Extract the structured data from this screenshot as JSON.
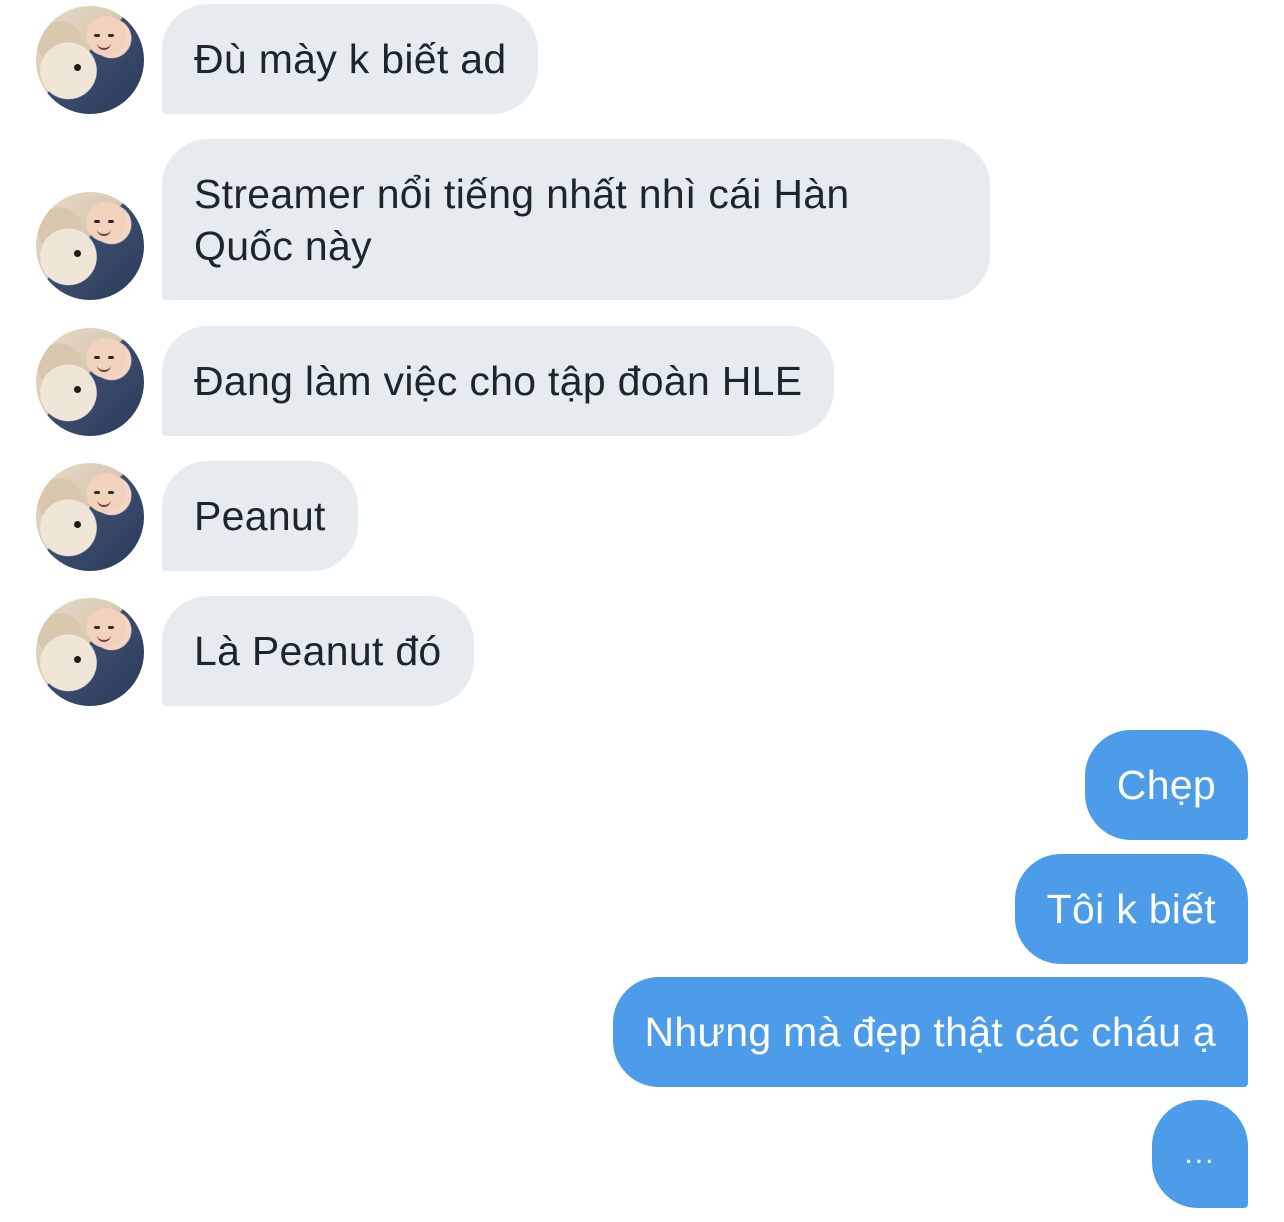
{
  "conversation": {
    "incoming": [
      {
        "text": "Đù mày k biết ad"
      },
      {
        "text": "Streamer nổi tiếng nhất nhì cái Hàn Quốc này"
      },
      {
        "text": "Đang làm việc cho tập đoàn HLE"
      },
      {
        "text": "Peanut"
      },
      {
        "text": "Là Peanut đó"
      }
    ],
    "outgoing": [
      {
        "text": "Chẹp"
      },
      {
        "text": "Tôi k biết"
      },
      {
        "text": "Nhưng mà đẹp thật các cháu ạ"
      },
      {
        "text": "..."
      }
    ]
  },
  "colors": {
    "incoming_bubble": "#e6ebef",
    "outgoing_bubble": "#4d9ce9",
    "incoming_text": "#1c2530",
    "outgoing_text": "#ffffff"
  },
  "icons": {
    "avatar": "contact-avatar-photo"
  }
}
